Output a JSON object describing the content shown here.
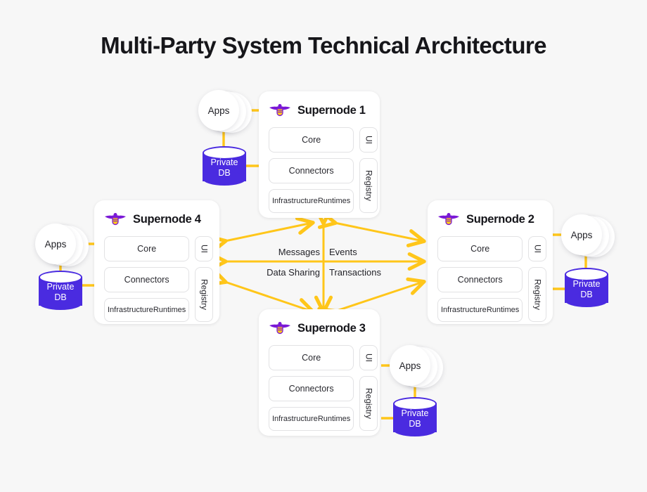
{
  "page": {
    "title": "Multi-Party System Technical Architecture",
    "background_color": "#f7f7f7",
    "accent_color": "#FFC61A",
    "brand_purple": "#4A2BE0"
  },
  "node_cells": {
    "core": "Core",
    "connectors": "Connectors",
    "infrastructure": "Infrastructure\nRuntimes",
    "infrastructure_line1": "Infrastructure",
    "infrastructure_line2": "Runtimes",
    "ui": "UI",
    "registry": "Registry"
  },
  "peripherals": {
    "apps": "Apps",
    "db_line1": "Private",
    "db_line2": "DB"
  },
  "nodes": [
    {
      "id": "supernode-1",
      "title": "Supernode 1",
      "peripheral_side": "left"
    },
    {
      "id": "supernode-2",
      "title": "Supernode 2",
      "peripheral_side": "right"
    },
    {
      "id": "supernode-3",
      "title": "Supernode 3",
      "peripheral_side": "right"
    },
    {
      "id": "supernode-4",
      "title": "Supernode 4",
      "peripheral_side": "left"
    }
  ],
  "flows": {
    "top_left": "Messages",
    "top_right": "Events",
    "bottom_left": "Data Sharing",
    "bottom_right": "Transactions"
  }
}
